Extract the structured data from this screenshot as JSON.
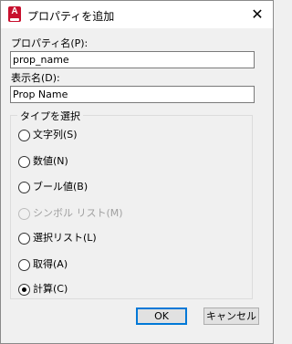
{
  "window": {
    "title": "プロパティを追加",
    "close_glyph": "✕",
    "app_icon_letter": "A"
  },
  "property_name": {
    "label": "プロパティ名(P):",
    "value": "prop_name"
  },
  "display_name": {
    "label": "表示名(D):",
    "value": "Prop Name"
  },
  "type_group": {
    "title": "タイプを選択",
    "options": [
      {
        "label": "文字列(S)",
        "checked": false,
        "enabled": true
      },
      {
        "label": "数値(N)",
        "checked": false,
        "enabled": true
      },
      {
        "label": "ブール値(B)",
        "checked": false,
        "enabled": true
      },
      {
        "label": "シンボル リスト(M)",
        "checked": false,
        "enabled": false
      },
      {
        "label": "選択リスト(L)",
        "checked": false,
        "enabled": true
      },
      {
        "label": "取得(A)",
        "checked": false,
        "enabled": true
      },
      {
        "label": "計算(C)",
        "checked": true,
        "enabled": true
      }
    ]
  },
  "buttons": {
    "ok": "OK",
    "cancel": "キャンセル"
  },
  "colors": {
    "app_icon": "#c8102e",
    "default_button_border": "#0078d7"
  }
}
